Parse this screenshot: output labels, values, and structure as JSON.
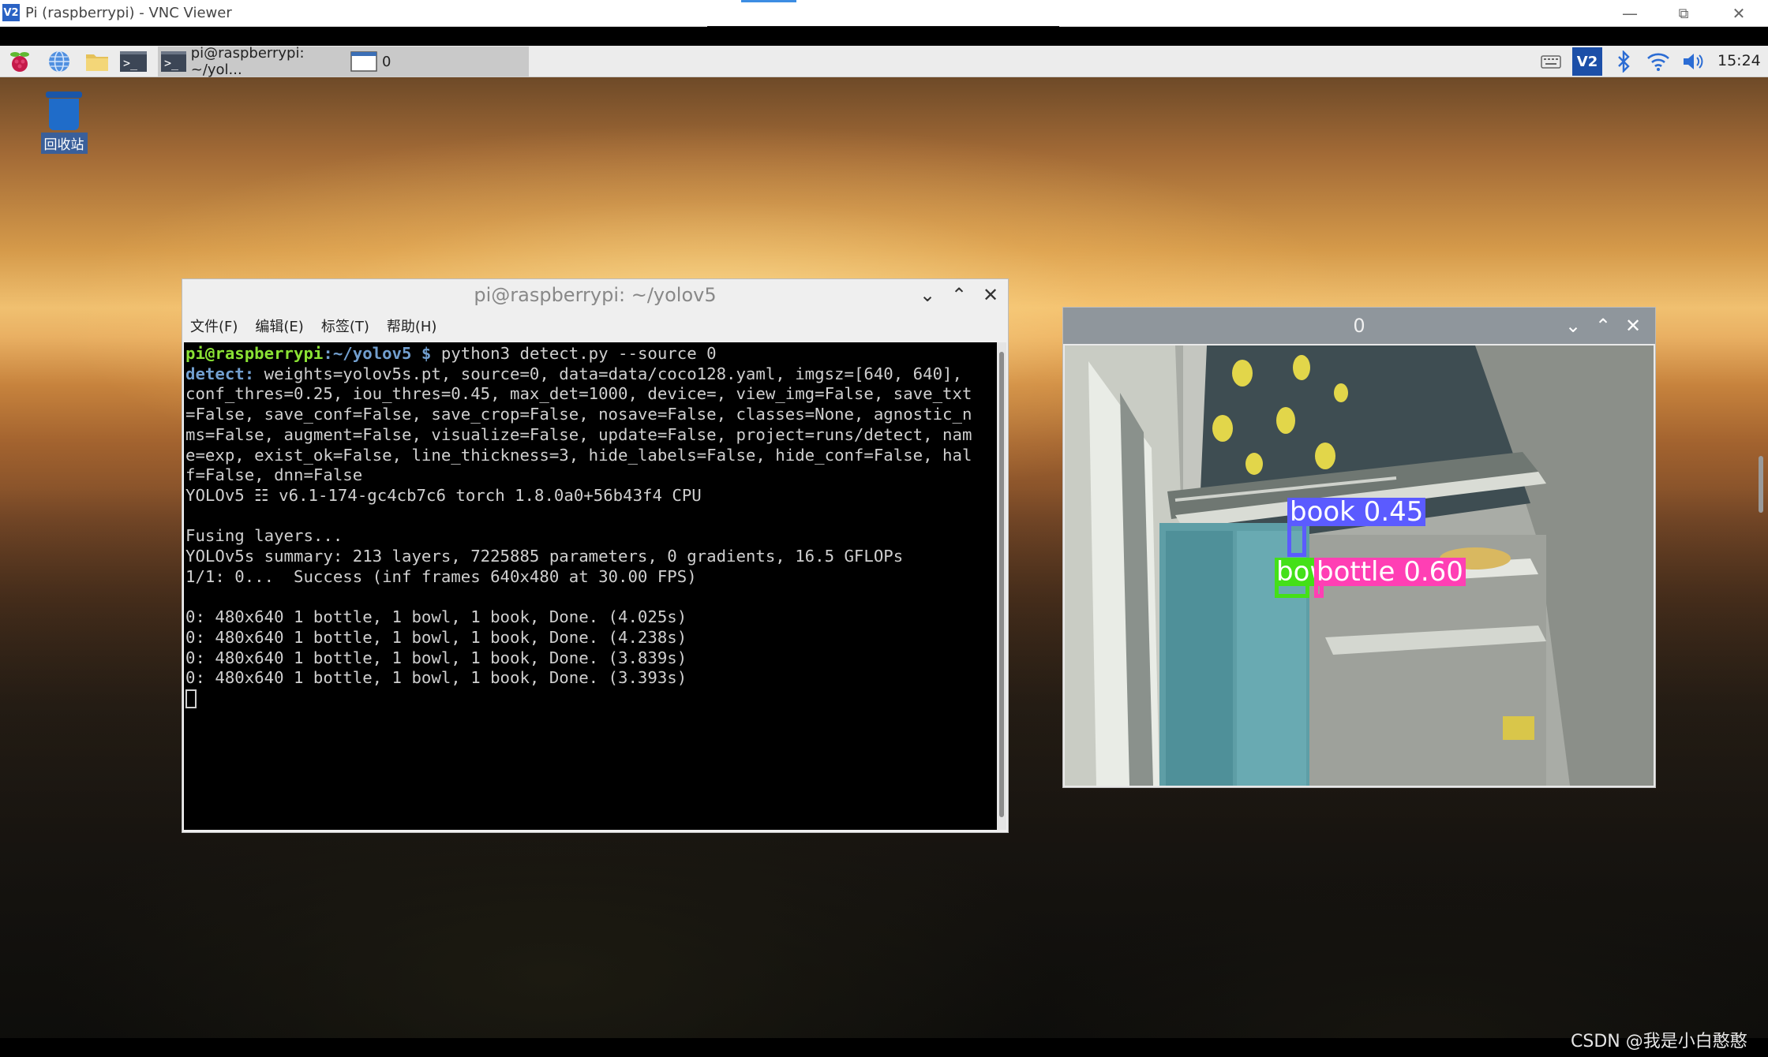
{
  "vnc": {
    "logo": "V2",
    "title": "Pi (raspberrypi) - VNC Viewer",
    "minimize": "—",
    "restore": "⧉",
    "close": "✕"
  },
  "taskbar": {
    "menu_icon": "raspberry-icon",
    "browser_icon": "globe-icon",
    "files_icon": "folder-icon",
    "terminal_icon": "terminal-icon",
    "tasks": [
      {
        "label": "pi@raspberrypi: ~/yol...",
        "icon": "terminal-icon"
      },
      {
        "label": "0",
        "icon": "window-icon"
      }
    ],
    "tray": [
      "keyboard-icon",
      "vnc-icon",
      "bluetooth-icon",
      "wifi-icon",
      "volume-icon"
    ],
    "tray_vnc_text": "V2",
    "terminal_glyph": ">_",
    "clock": "15:24"
  },
  "desktop": {
    "trash_label": "回收站"
  },
  "terminal": {
    "title": "pi@raspberrypi: ~/yolov5",
    "menu": [
      "文件(F)",
      "编辑(E)",
      "标签(T)",
      "帮助(H)"
    ],
    "prompt_user": "pi@raspberrypi",
    "prompt_path": ":~/yolov5 $",
    "command": " python3 detect.py --source 0",
    "detect_key": "detect:",
    "detect_rest": " weights=yolov5s.pt, source=0, data=data/coco128.yaml, imgsz=[640, 640],",
    "lines": [
      "conf_thres=0.25, iou_thres=0.45, max_det=1000, device=, view_img=False, save_txt",
      "=False, save_conf=False, save_crop=False, nosave=False, classes=None, agnostic_n",
      "ms=False, augment=False, visualize=False, update=False, project=runs/detect, nam",
      "e=exp, exist_ok=False, line_thickness=3, hide_labels=False, hide_conf=False, hal",
      "f=False, dnn=False",
      "YOLOv5 ☷ v6.1-174-gc4cb7c6 torch 1.8.0a0+56b43f4 CPU",
      "",
      "Fusing layers...",
      "YOLOv5s summary: 213 layers, 7225885 parameters, 0 gradients, 16.5 GFLOPs",
      "1/1: 0...  Success (inf frames 640x480 at 30.00 FPS)",
      "",
      "0: 480x640 1 bottle, 1 bowl, 1 book, Done. (4.025s)",
      "0: 480x640 1 bottle, 1 bowl, 1 book, Done. (4.238s)",
      "0: 480x640 1 bottle, 1 bowl, 1 book, Done. (3.839s)",
      "0: 480x640 1 bottle, 1 bowl, 1 book, Done. (3.393s)"
    ]
  },
  "camera": {
    "title": "0",
    "detections": [
      {
        "label": "book 0.45",
        "color": "#5b5bff"
      },
      {
        "label": "bowl",
        "color": "#44e018"
      },
      {
        "label": "bottle 0.60",
        "color": "#ff3fb4"
      }
    ]
  },
  "watermark": "CSDN @我是小白憨憨",
  "window_controls": {
    "minimize": "⌄",
    "maximize": "⌃",
    "close": "✕"
  }
}
